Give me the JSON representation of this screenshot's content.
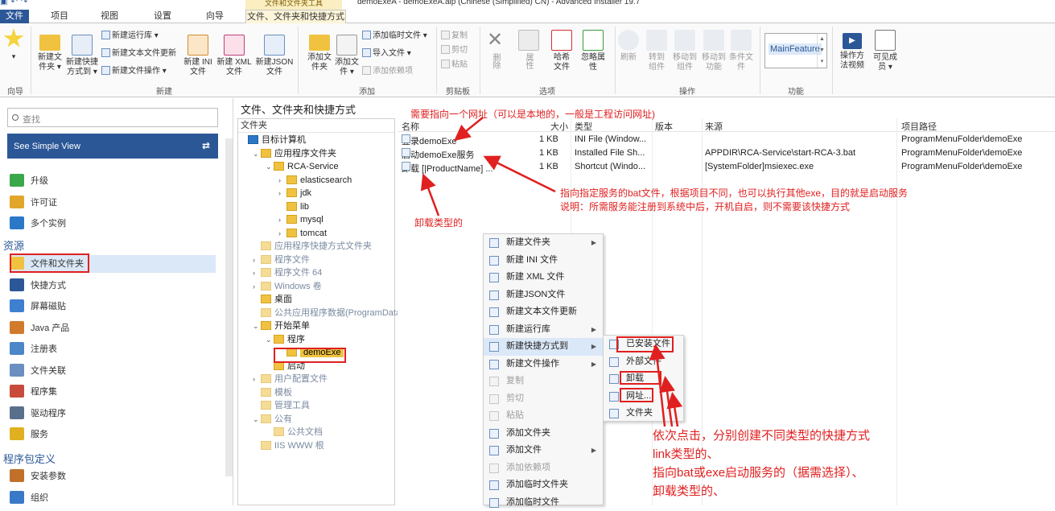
{
  "window": {
    "title": "demoExeA - demoExeA.aip (Chinese (Simplified) CN) - Advanced Installer 19.7",
    "context_tab_group": "文件和文件夹工具"
  },
  "tabs": [
    "文件",
    "项目",
    "视图",
    "设置",
    "向导",
    "文件、文件夹和快捷方式"
  ],
  "ribbon": {
    "wizard_group": "向导",
    "new_group": "新建",
    "add_group": "添加",
    "clipboard_group": "剪贴板",
    "options_group": "选项",
    "actions_group": "操作",
    "feature_group": "功能",
    "buttons": {
      "new_file": "新建文件夹",
      "new_shortcut": "新建快捷方式到",
      "new_launcher": "新建运行库",
      "new_text_update": "新建文本文件更新",
      "new_file_op": "新建文件操作",
      "new_ini": "新建 INI 文件",
      "new_xml": "新建 XML 文件",
      "new_json": "新建JSON 文件",
      "add_folder": "添加文件夹",
      "add_file": "添加文件",
      "add_temp_file": "添加临时文件",
      "import_file": "导入文件",
      "add_dependency": "添加依赖项",
      "copy": "复制",
      "cut": "剪切",
      "paste": "粘贴",
      "delete": "删除",
      "properties": "属性",
      "hash_file": "哈希文件",
      "ignore_props": "忽略属性",
      "refresh": "刷新",
      "goto_comp": "转到组件",
      "move_to_comp": "移动到组件",
      "move_to_feature": "移动到功能",
      "cond_file": "条件文件",
      "feature_value": "MainFeature",
      "howto_video": "操作方法视频",
      "visible_members": "可见成员"
    }
  },
  "left_panel": {
    "search_placeholder": "查找",
    "simple_view": "See Simple View",
    "items_top": [
      {
        "label": "升级",
        "icon": "upgrade-icon"
      },
      {
        "label": "许可证",
        "icon": "license-icon"
      },
      {
        "label": "多个实例",
        "icon": "instances-icon"
      }
    ],
    "resources_header": "资源",
    "resources": [
      {
        "label": "文件和文件夹",
        "icon": "folder-icon",
        "selected": true
      },
      {
        "label": "快捷方式",
        "icon": "shortcut-icon"
      },
      {
        "label": "屏幕磁贴",
        "icon": "tile-icon"
      },
      {
        "label": "Java 产品",
        "icon": "java-icon"
      },
      {
        "label": "注册表",
        "icon": "registry-icon"
      },
      {
        "label": "文件关联",
        "icon": "file-assoc-icon"
      },
      {
        "label": "程序集",
        "icon": "assembly-icon"
      },
      {
        "label": "驱动程序",
        "icon": "driver-icon"
      },
      {
        "label": "服务",
        "icon": "service-icon"
      }
    ],
    "package_header": "程序包定义",
    "package": [
      {
        "label": "安装参数",
        "icon": "install-params-icon"
      },
      {
        "label": "组织",
        "icon": "organization-icon"
      }
    ]
  },
  "center": {
    "caption": "文件、文件夹和快捷方式",
    "tree_header": "文件夹",
    "tree": [
      {
        "label": "目标计算机",
        "depth": 0,
        "arrow": "",
        "style": "root"
      },
      {
        "label": "应用程序文件夹",
        "depth": 1,
        "arrow": "v",
        "style": "normal"
      },
      {
        "label": "RCA-Service",
        "depth": 2,
        "arrow": "v",
        "style": "normal"
      },
      {
        "label": "elasticsearch",
        "depth": 3,
        "arrow": ">",
        "style": "normal"
      },
      {
        "label": "jdk",
        "depth": 3,
        "arrow": ">",
        "style": "normal"
      },
      {
        "label": "lib",
        "depth": 3,
        "arrow": "",
        "style": "normal"
      },
      {
        "label": "mysql",
        "depth": 3,
        "arrow": ">",
        "style": "normal"
      },
      {
        "label": "tomcat",
        "depth": 3,
        "arrow": ">",
        "style": "normal"
      },
      {
        "label": "应用程序快捷方式文件夹",
        "depth": 1,
        "arrow": "",
        "style": "grey"
      },
      {
        "label": "程序文件",
        "depth": 1,
        "arrow": ">",
        "style": "grey"
      },
      {
        "label": "程序文件 64",
        "depth": 1,
        "arrow": ">",
        "style": "grey"
      },
      {
        "label": "Windows 卷",
        "depth": 1,
        "arrow": ">",
        "style": "grey"
      },
      {
        "label": "桌面",
        "depth": 1,
        "arrow": "",
        "style": "normal"
      },
      {
        "label": "公共应用程序数据(ProgramData)",
        "depth": 1,
        "arrow": "",
        "style": "grey"
      },
      {
        "label": "开始菜单",
        "depth": 1,
        "arrow": "v",
        "style": "normal"
      },
      {
        "label": "程序",
        "depth": 2,
        "arrow": "v",
        "style": "normal"
      },
      {
        "label": "demoExe",
        "depth": 3,
        "arrow": "",
        "style": "selected"
      },
      {
        "label": "启动",
        "depth": 2,
        "arrow": "",
        "style": "normal"
      },
      {
        "label": "用户配置文件",
        "depth": 1,
        "arrow": ">",
        "style": "grey"
      },
      {
        "label": "模板",
        "depth": 1,
        "arrow": "",
        "style": "grey"
      },
      {
        "label": "管理工具",
        "depth": 1,
        "arrow": "",
        "style": "grey"
      },
      {
        "label": "公有",
        "depth": 1,
        "arrow": "v",
        "style": "grey"
      },
      {
        "label": "公共文档",
        "depth": 2,
        "arrow": "",
        "style": "grey"
      },
      {
        "label": "IIS WWW 根",
        "depth": 1,
        "arrow": "",
        "style": "grey"
      }
    ],
    "file_columns": [
      "名称",
      "大小",
      "类型",
      "版本",
      "来源",
      "项目路径"
    ],
    "files": [
      {
        "name": "登录demoExe",
        "size": "1 KB",
        "type": "INI File (Window...",
        "version": "",
        "source": "",
        "path": "ProgramMenuFolder\\demoExe"
      },
      {
        "name": "启动demoExe服务",
        "size": "1 KB",
        "type": "Installed File Sh...",
        "version": "",
        "source": "APPDIR\\RCA-Service\\start-RCA-3.bat",
        "path": "ProgramMenuFolder\\demoExe"
      },
      {
        "name": "卸载 [|ProductName] ...",
        "size": "1 KB",
        "type": "Shortcut (Windo...",
        "version": "",
        "source": "[SystemFolder]msiexec.exe",
        "path": "ProgramMenuFolder\\demoExe"
      }
    ]
  },
  "context_menu": [
    {
      "label": "新建文件夹",
      "sub": true,
      "dis": false
    },
    {
      "label": "新建 INI 文件",
      "sub": false,
      "dis": false
    },
    {
      "label": "新建 XML 文件",
      "sub": false,
      "dis": false
    },
    {
      "label": "新建JSON文件",
      "sub": false,
      "dis": false
    },
    {
      "label": "新建文本文件更新",
      "sub": false,
      "dis": false
    },
    {
      "label": "新建运行库",
      "sub": true,
      "dis": false
    },
    {
      "label": "新建快捷方式到",
      "sub": true,
      "dis": false,
      "hl": true
    },
    {
      "label": "新建文件操作",
      "sub": true,
      "dis": false
    },
    {
      "label": "复制",
      "sub": false,
      "dis": true
    },
    {
      "label": "剪切",
      "sub": false,
      "dis": true
    },
    {
      "label": "粘贴",
      "sub": false,
      "dis": true
    },
    {
      "label": "添加文件夹",
      "sub": false,
      "dis": false
    },
    {
      "label": "添加文件",
      "sub": true,
      "dis": false
    },
    {
      "label": "添加依赖项",
      "sub": false,
      "dis": true
    },
    {
      "label": "添加临时文件夹",
      "sub": false,
      "dis": false
    },
    {
      "label": "添加临时文件",
      "sub": false,
      "dis": false
    }
  ],
  "submenu": [
    "已安装文件",
    "外部文件",
    "卸载",
    "网址...",
    "文件夹"
  ],
  "annotations": {
    "url_note": "需要指向一个网址（可以是本地的，一般是工程访问网址)",
    "bat_note_1": "指向指定服务的bat文件，根据项目不同，也可以执行其他exe，目的就是启动服务",
    "bat_note_2": "说明：所需服务能注册到系统中后，开机自启，则不需要该快捷方式",
    "uninstall_note": "卸载类型的",
    "click_note_1": "依次点击，分别创建不同类型的快捷方式",
    "click_note_2": "link类型的、",
    "click_note_3": "指向bat或exe启动服务的（据需选择）、",
    "click_note_4": "卸载类型的、"
  },
  "colors": {
    "accent": "#2b5797",
    "annotation": "#e02020",
    "selection": "#dbe8f8"
  }
}
